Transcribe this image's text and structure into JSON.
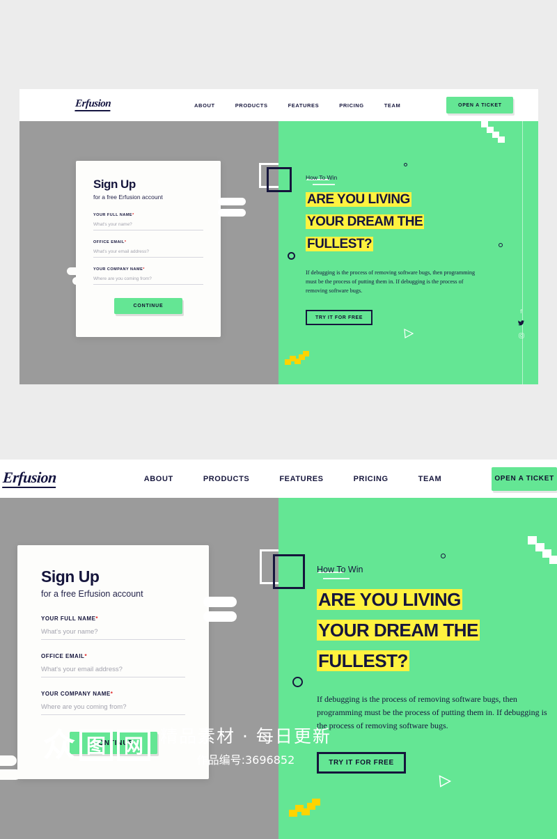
{
  "theme": {
    "green": "#64e694",
    "gray_panel": "#9b9b9b",
    "navy": "#15153c",
    "yellow_highlight": "#fff23f",
    "yellow_zigzag": "#ffd400",
    "page_bg": "#ececec",
    "card_bg": "#fdfdfb",
    "required_red": "#e02727"
  },
  "brand": {
    "logo_text": "Erfusion"
  },
  "nav": {
    "items": [
      {
        "label": "ABOUT"
      },
      {
        "label": "PRODUCTS"
      },
      {
        "label": "FEATURES"
      },
      {
        "label": "PRICING"
      },
      {
        "label": "TEAM"
      }
    ],
    "cta_label": "OPEN A TICKET"
  },
  "signup": {
    "title": "Sign Up",
    "subtitle": "for a free Erfusion account",
    "fields": [
      {
        "label": "YOUR FULL NAME",
        "required": "*",
        "placeholder": "What's your name?",
        "value": ""
      },
      {
        "label": "OFFICE EMAIL",
        "required": "*",
        "placeholder": "What's your email address?",
        "value": ""
      },
      {
        "label": "YOUR COMPANY NAME",
        "required": "*",
        "placeholder": "Where are you coming from?",
        "value": ""
      }
    ],
    "submit_label": "CONTINUE"
  },
  "hero": {
    "kicker": "How To Win",
    "headline_lines": [
      "ARE YOU LIVING",
      "YOUR DREAM THE",
      "FULLEST?"
    ],
    "paragraph": "If debugging is the process of removing software bugs, then programming must be the process of putting them in. If debugging is the process of removing software bugs.",
    "cta_label": "TRY IT FOR FREE",
    "social": [
      {
        "name": "facebook-icon",
        "glyph": "f",
        "active": false
      },
      {
        "name": "twitter-icon",
        "glyph": "✉",
        "active": true
      },
      {
        "name": "instagram-icon",
        "glyph": "▣",
        "active": false
      }
    ]
  },
  "watermark": {
    "mark_1": "众",
    "mark_2": "图",
    "mark_3": "网",
    "title": "精品素材 · 每日更新",
    "subtitle": "作品编号:3696852"
  }
}
